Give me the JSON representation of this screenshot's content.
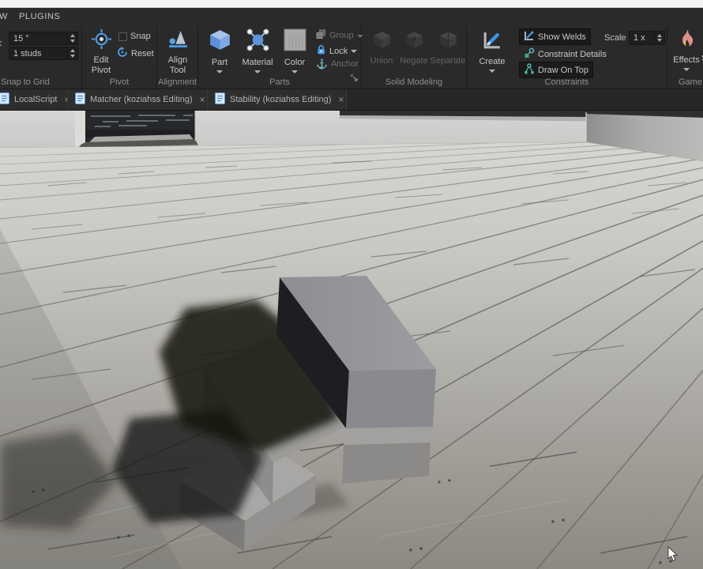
{
  "menu": {
    "partial_left_label": "W",
    "plugins_label": "PLUGINS"
  },
  "ribbon": {
    "snap_to_grid": {
      "section_label": "Snap to Grid",
      "rotate_value": "15 °",
      "move_value": "1 studs"
    },
    "pivot": {
      "section_label": "Pivot",
      "edit_pivot_label": "Edit Pivot",
      "snap_label": "Snap",
      "reset_label": "Reset"
    },
    "alignment": {
      "section_label": "Alignment",
      "align_tool_label": "Align Tool"
    },
    "parts": {
      "section_label": "Parts",
      "part_label": "Part",
      "material_label": "Material",
      "color_label": "Color",
      "group_label": "Group",
      "lock_label": "Lock",
      "anchor_label": "Anchor"
    },
    "solid_modeling": {
      "section_label": "Solid Modeling",
      "union_label": "Union",
      "negate_label": "Negate",
      "separate_label": "Separate"
    },
    "constraints": {
      "section_label": "Constraints",
      "create_label": "Create",
      "show_welds_label": "Show Welds",
      "constraint_details_label": "Constraint Details",
      "draw_on_top_label": "Draw On Top",
      "scale_label": "Scale",
      "scale_value": "1 x"
    },
    "game": {
      "section_label": "Game",
      "effects_label": "Effects",
      "partial_right_label": "S"
    }
  },
  "tabs": {
    "close_glyph": "×",
    "items": [
      {
        "label": "LocalScript"
      },
      {
        "label": "Matcher (koziahss Editing)"
      },
      {
        "label": "Stability (koziahss Editing)"
      }
    ]
  },
  "viewport": {
    "scene_description": "3D room with light wooden plank floor, gray walls, dark doorway opening at back left, corner at back right, and a gray three-step block staircase casting soft dark shadows; white mouse cursor at bottom right"
  },
  "colors": {
    "accent": "#4da0e8",
    "menubar-bg": "#2b2b2b",
    "ribbon-bg": "#2a2a2a",
    "tabbar-bg": "#272727",
    "tab-bg": "#2d2d2d",
    "input-bg": "#1f1f1f",
    "toggled-bg": "#1b1b1b",
    "text-primary": "#c8c8c8",
    "text-muted": "#8f8f8f",
    "text-disabled": "#646464",
    "top-strip": "#f3f3f3"
  },
  "scene_palette": {
    "wall": "#cbcac8",
    "right_wall": "#a9a8a6",
    "doorway_dark": "#26282b",
    "floor_far": "#d5d4d1",
    "floor_near": "#8e8b85",
    "block_top": "#97969a",
    "block_front": "#8a898d",
    "block_dark_side": "#1e1e22",
    "shadow": "#151410",
    "flame_pink": "#dd8f8c",
    "flame_yellow": "#e9bc4e"
  }
}
